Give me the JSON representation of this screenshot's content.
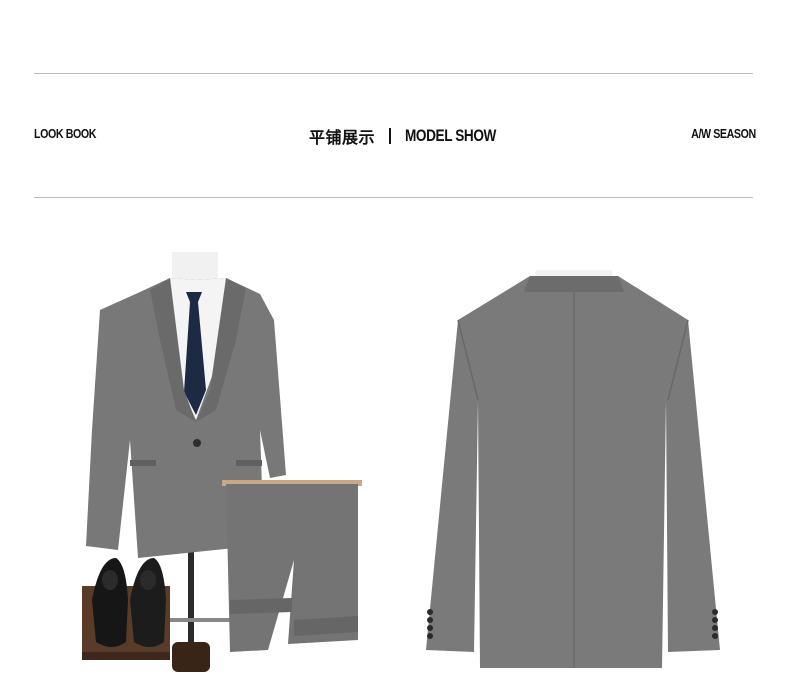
{
  "header": {
    "left_label": "LOOK BOOK",
    "title_cn": "平铺展示",
    "title_en": "MODEL SHOW",
    "right_label": "A/W SEASON"
  },
  "images": {
    "front": {
      "subject": "grey suit front on mannequin with tie, folded trousers and black shoes"
    },
    "back": {
      "subject": "grey suit jacket back view"
    }
  },
  "colors": {
    "suit": "#777777",
    "suit_dark": "#5f5f5f",
    "tie": "#1c2a44",
    "shirt": "#f4f4f4",
    "shoe": "#1a1a1a",
    "wood": "#5a3b28",
    "rule": "#bdbdbd"
  }
}
